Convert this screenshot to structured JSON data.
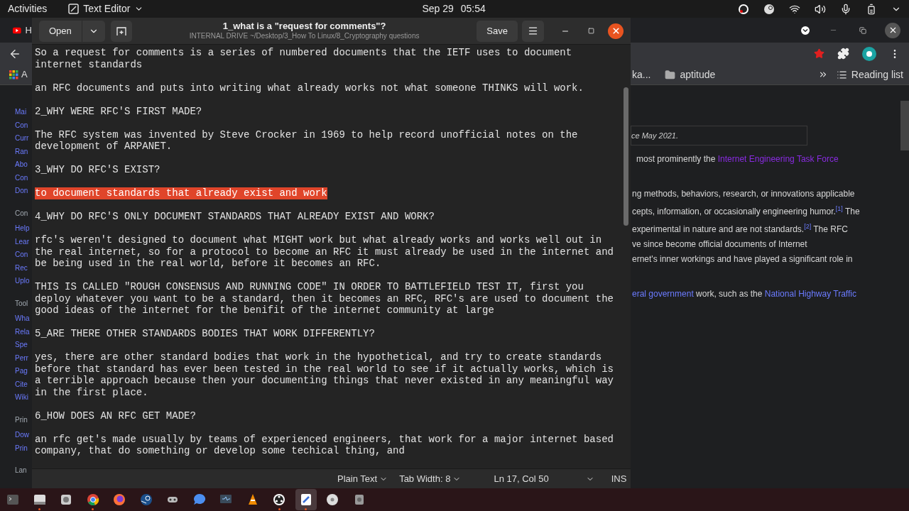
{
  "top_bar": {
    "activities": "Activities",
    "app_menu": "Text Editor",
    "date": "Sep 29",
    "time": "05:54"
  },
  "editor": {
    "open_button": "Open",
    "title": "1_what is a \"request for comments\"?",
    "path": "INTERNAL DRIVE ~/Desktop/3_How To Linux/8_Cryptography questions",
    "save_button": "Save",
    "paragraphs": [
      {
        "selected": false,
        "lines": [
          "So a request for comments is a series of numbered documents that the IETF uses to document",
          "internet standards"
        ]
      },
      {
        "selected": false,
        "lines": [
          "an RFC documents and puts into writing what already works not what someone THINKS will work."
        ]
      },
      {
        "selected": false,
        "lines": [
          "2_WHY WERE RFC'S FIRST MADE?"
        ]
      },
      {
        "selected": false,
        "lines": [
          "The RFC system was invented by Steve Crocker in 1969 to help record unofficial notes on the",
          "development of ARPANET."
        ]
      },
      {
        "selected": false,
        "lines": [
          "3_WHY DO RFC'S EXIST?"
        ]
      },
      {
        "selected": true,
        "lines": [
          "to document standards that already exist and work"
        ]
      },
      {
        "selected": false,
        "lines": [
          "4_WHY DO RFC'S ONLY DOCUMENT STANDARDS THAT ALREADY EXIST AND WORK?"
        ]
      },
      {
        "selected": false,
        "lines": [
          "rfc's weren't designed to document what MIGHT work but what already works and works well out in",
          "the real internet, so for a protocol to become an RFC it must already be used in the internet and",
          "be being used in the real world, before it becomes an RFC."
        ]
      },
      {
        "selected": false,
        "lines": [
          "THIS IS CALLED \"ROUGH CONSENSUS AND RUNNING CODE\" IN ORDER TO BATTLEFIELD TEST IT, first you",
          "deploy whatever you want to be a standard, then it becomes an RFC, RFC's are used to document the",
          "good ideas of the internet for the benifit of the internet community at large"
        ]
      },
      {
        "selected": false,
        "lines": [
          "5_ARE THERE OTHER STANDARDS BODIES THAT WORK DIFFERENTLY?"
        ]
      },
      {
        "selected": false,
        "lines": [
          "yes, there are other standard bodies that work in the hypothetical, and try to create standards",
          "before that standard has ever been tested in the real world to see if it actually works, which is",
          "a terrible approach because then your documenting things that never existed in any meaningful way",
          "in the first place."
        ]
      },
      {
        "selected": false,
        "lines": [
          "6_HOW DOES AN RFC GET MADE?"
        ]
      },
      {
        "selected": false,
        "lines": [
          "an rfc get's made usually by teams of experienced engineers, that work for a major internet based",
          "company, that do something or develop some techical thing, and"
        ]
      }
    ],
    "status_bar": {
      "language": "Plain Text",
      "tab_width": "Tab Width: 8",
      "position": "Ln 17, Col 50",
      "mode": "INS"
    }
  },
  "browser": {
    "tab_fragment": "H",
    "apps_fragment": "A",
    "bookmarks": [
      {
        "label": "ka...",
        "kind": "page"
      },
      {
        "label": "aptitude",
        "kind": "folder"
      }
    ],
    "reading_list": "Reading list",
    "sidebar": [
      {
        "label": "Mai",
        "kind": "link"
      },
      {
        "label": "Con",
        "kind": "link"
      },
      {
        "label": "Curr",
        "kind": "link"
      },
      {
        "label": "Ran",
        "kind": "link"
      },
      {
        "label": "Abo",
        "kind": "link"
      },
      {
        "label": "Con",
        "kind": "link"
      },
      {
        "label": "Don",
        "kind": "link"
      },
      {
        "label": "Con",
        "kind": "heading"
      },
      {
        "label": "Help",
        "kind": "link"
      },
      {
        "label": "Lear",
        "kind": "link"
      },
      {
        "label": "Con",
        "kind": "link"
      },
      {
        "label": "Rec",
        "kind": "link"
      },
      {
        "label": "Uplo",
        "kind": "link"
      },
      {
        "label": "Tool",
        "kind": "heading"
      },
      {
        "label": "Wha",
        "kind": "link"
      },
      {
        "label": "Rela",
        "kind": "link"
      },
      {
        "label": "Spe",
        "kind": "link"
      },
      {
        "label": "Perr",
        "kind": "link"
      },
      {
        "label": "Pag",
        "kind": "link"
      },
      {
        "label": "Cite",
        "kind": "link"
      },
      {
        "label": "Wiki",
        "kind": "link"
      },
      {
        "label": "Prin",
        "kind": "heading"
      },
      {
        "label": "Dow",
        "kind": "link"
      },
      {
        "label": "Prin",
        "kind": "link"
      },
      {
        "label": "Lan",
        "kind": "heading"
      }
    ],
    "article": {
      "note": "ce May 2021.",
      "paragraphs": [
        [
          [
            {
              "kind": "text",
              "text": "most prominently the "
            },
            {
              "kind": "visited",
              "text": "Internet Engineering Task Force"
            }
          ]
        ],
        [
          [
            {
              "kind": "text",
              "text": "ng methods, behaviors, research, or innovations applicable"
            }
          ],
          [
            {
              "kind": "text",
              "text": "cepts, information, or occasionally engineering humor."
            },
            {
              "kind": "ref",
              "text": "[1]"
            },
            {
              "kind": "text",
              "text": " The"
            }
          ],
          [
            {
              "kind": "text",
              "text": "experimental in nature and are not standards."
            },
            {
              "kind": "ref",
              "text": "[2]"
            },
            {
              "kind": "text",
              "text": " The RFC"
            }
          ],
          [
            {
              "kind": "text",
              "text": "ve since become official documents of Internet"
            }
          ],
          [
            {
              "kind": "text",
              "text": "ernet's inner workings and have played a significant role in"
            }
          ]
        ],
        [
          [
            {
              "kind": "link",
              "text": "eral government"
            },
            {
              "kind": "text",
              "text": " work, such as the "
            },
            {
              "kind": "link",
              "text": "National Highway Traffic"
            }
          ]
        ]
      ]
    }
  },
  "taskbar": [
    {
      "kind": "terminal",
      "running": false,
      "active": false
    },
    {
      "kind": "window",
      "running": true,
      "active": false
    },
    {
      "kind": "disk",
      "running": false,
      "active": false
    },
    {
      "kind": "chrome",
      "running": true,
      "active": false
    },
    {
      "kind": "firefox",
      "running": false,
      "active": false
    },
    {
      "kind": "steam",
      "running": false,
      "active": false
    },
    {
      "kind": "gamepad",
      "running": false,
      "active": false
    },
    {
      "kind": "chat",
      "running": false,
      "active": false
    },
    {
      "kind": "monitor",
      "running": false,
      "active": false
    },
    {
      "kind": "cone",
      "running": false,
      "active": false
    },
    {
      "kind": "dial",
      "running": true,
      "active": false
    },
    {
      "kind": "editor",
      "running": true,
      "active": true
    },
    {
      "kind": "disc",
      "running": false,
      "active": false
    },
    {
      "kind": "drive",
      "running": false,
      "active": false
    }
  ]
}
